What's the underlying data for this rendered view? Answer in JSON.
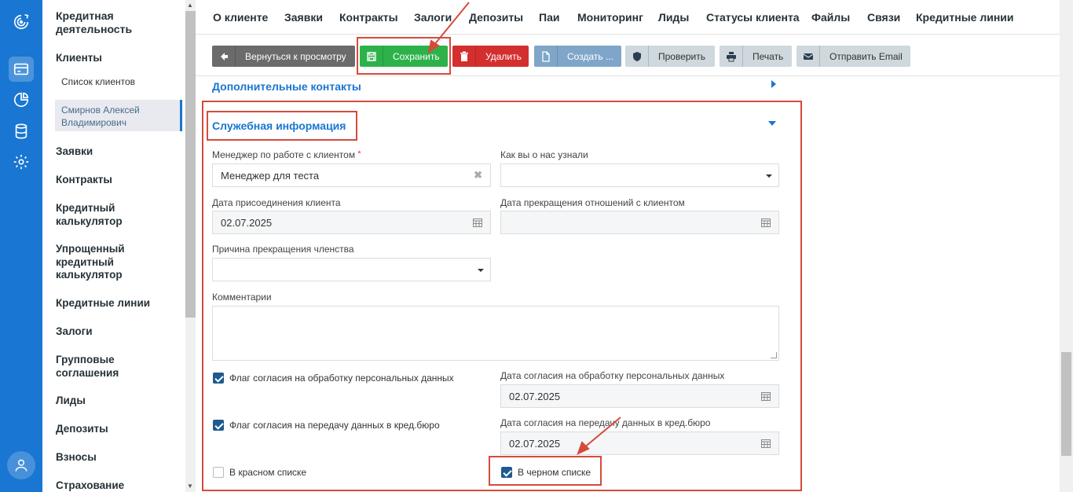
{
  "sidebar": {
    "title": "Кредитная деятельность",
    "clients": "Клиенты",
    "client_list": "Список клиентов",
    "active_client": "Смирнов Алексей Владимирович",
    "items": [
      "Заявки",
      "Контракты",
      "Кредитный калькулятор",
      "Упрощенный кредитный калькулятор",
      "Кредитные линии",
      "Залоги",
      "Групповые соглашения",
      "Лиды",
      "Депозиты",
      "Взносы",
      "Страхование"
    ]
  },
  "topnav": [
    "О клиенте",
    "Заявки",
    "Контракты",
    "Залоги",
    "Депозиты",
    "Паи",
    "Мониторинг",
    "Лиды",
    "Статусы клиента",
    "Файлы",
    "Связи",
    "Кредитные линии"
  ],
  "toolbar": {
    "back": "Вернуться к просмотру",
    "save": "Сохранить",
    "delete": "Удалить",
    "create": "Создать ...",
    "check": "Проверить",
    "print": "Печать",
    "email": "Отправить Email"
  },
  "sections": {
    "contacts": "Дополнительные контакты",
    "service": "Служебная информация"
  },
  "form": {
    "manager_label": "Менеджер по работе с клиентом",
    "manager_required": "*",
    "manager_value": "Менеджер для теста",
    "source_label": "Как вы о нас узнали",
    "join_label": "Дата присоединения клиента",
    "join_value": "02.07.2025",
    "end_label": "Дата прекращения отношений с клиентом",
    "reason_label": "Причина прекращения членства",
    "comments_label": "Комментарии",
    "pd_flag": "Флаг согласия на обработку персональных данных",
    "pd_date_label": "Дата согласия на обработку персональных данных",
    "pd_date_value": "02.07.2025",
    "bureau_flag": "Флаг согласия на передачу данных в кред.бюро",
    "bureau_date_label": "Дата согласия на передачу данных в кред.бюро",
    "bureau_date_value": "02.07.2025",
    "red_list": "В красном списке",
    "black_list": "В черном списке"
  },
  "colors": {
    "rail": "#1976d2",
    "accent": "#1976d2",
    "save": "#2db24a",
    "delete": "#d32f2f",
    "annotation": "#d64a3c"
  }
}
